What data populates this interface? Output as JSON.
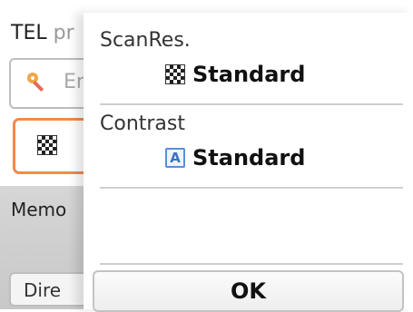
{
  "background": {
    "tel_label": "TEL",
    "tel_label_rest": "pr",
    "entry_label": "Er",
    "memory_label": "Memo",
    "direct_label": "Dire"
  },
  "panel": {
    "scan_resolution": {
      "name": "ScanRes.",
      "value": "Standard",
      "icon": "checkerboard-resolution-icon"
    },
    "contrast": {
      "name": "Contrast",
      "value": "Standard",
      "icon": "contrast-a-icon",
      "icon_glyph": "A"
    },
    "ok_label": "OK"
  },
  "colors": {
    "selection_border": "#f28a4a",
    "contrast_icon_blue": "#5b8fd6"
  }
}
